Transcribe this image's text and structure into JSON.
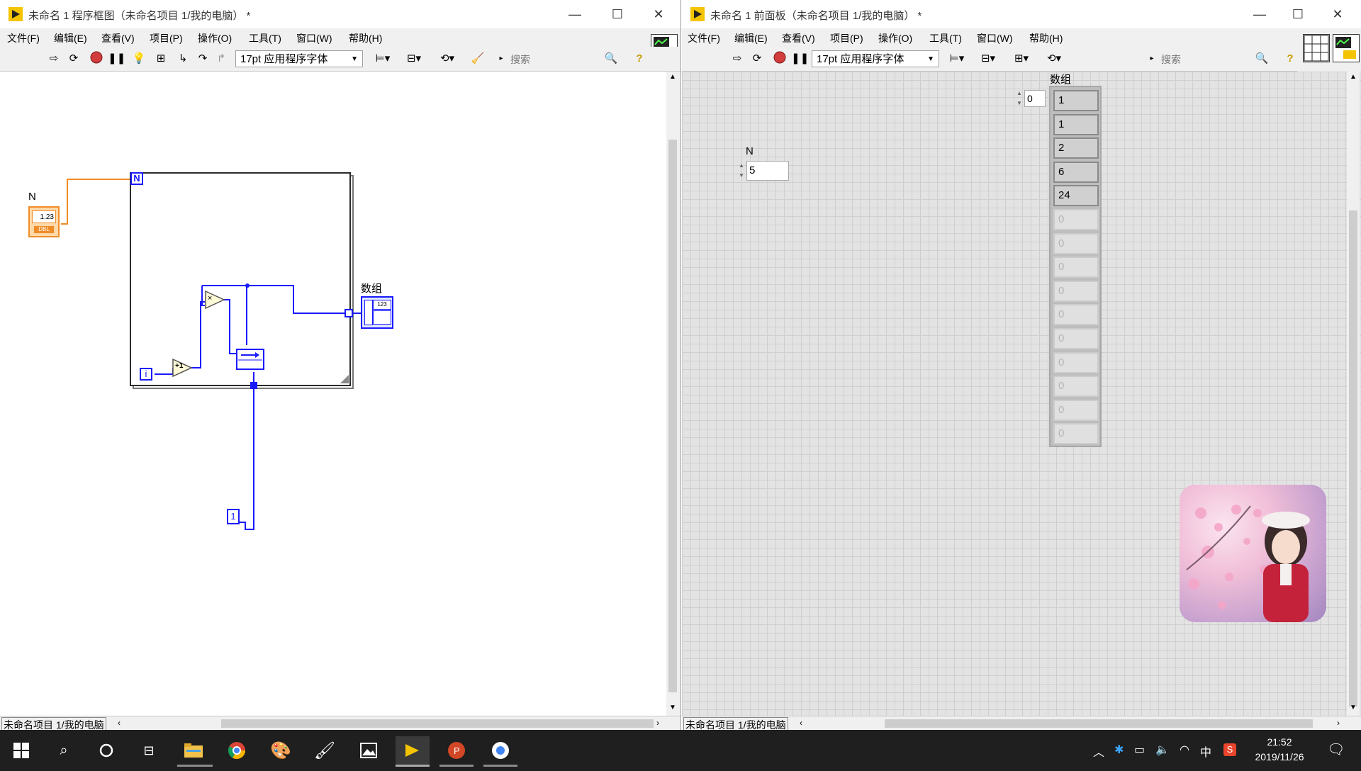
{
  "block_diagram_window": {
    "title": "未命名 1 程序框图（未命名项目 1/我的电脑） *",
    "menus": [
      "文件(F)",
      "编辑(E)",
      "查看(V)",
      "项目(P)",
      "操作(O)",
      "工具(T)",
      "窗口(W)",
      "帮助(H)"
    ],
    "font_selector": "17pt 应用程序字体",
    "search_placeholder": "搜索",
    "help_glyph": "?",
    "status_label": "未命名项目 1/我的电脑",
    "diagram": {
      "n_control_label": "N",
      "n_control_text": "1.23",
      "n_control_type": "DBL",
      "for_loop_count_terminal": "N",
      "for_loop_iteration_terminal": "i",
      "increment_label": "+1",
      "multiply_label": "×",
      "constant_value": "1",
      "array_indicator_label": "数组",
      "array_indicator_text": "123"
    }
  },
  "front_panel_window": {
    "title": "未命名 1 前面板（未命名项目 1/我的电脑） *",
    "menus": [
      "文件(F)",
      "编辑(E)",
      "查看(V)",
      "项目(P)",
      "操作(O)",
      "工具(T)",
      "窗口(W)",
      "帮助(H)"
    ],
    "font_selector": "17pt 应用程序字体",
    "search_placeholder": "搜索",
    "help_glyph": "?",
    "status_label": "未命名项目 1/我的电脑",
    "n_control": {
      "label": "N",
      "value": "5"
    },
    "array_indicator": {
      "label": "数组",
      "index": "0",
      "elements": [
        "1",
        "1",
        "2",
        "6",
        "24",
        "0",
        "0",
        "0",
        "0",
        "0",
        "0",
        "0",
        "0",
        "0",
        "0"
      ],
      "active_count": 5
    }
  },
  "taskbar": {
    "apps": [
      "start-icon",
      "search-icon",
      "cortana-icon",
      "task-view-icon",
      "file-explorer-icon",
      "chrome-icon",
      "paint-3d-icon",
      "paint-icon",
      "photos-icon",
      "labview-icon",
      "powerpoint-icon",
      "chrome-canary-icon"
    ],
    "tray_ime": "中",
    "clock_time": "21:52",
    "clock_date": "2019/11/26"
  },
  "colors": {
    "wire_orange": "#f08c28",
    "wire_blue": "#1a1aff",
    "loop_border": "#2a2a2a",
    "grid_bg": "#e3e3e3",
    "taskbar_bg": "#1f1f1f"
  }
}
